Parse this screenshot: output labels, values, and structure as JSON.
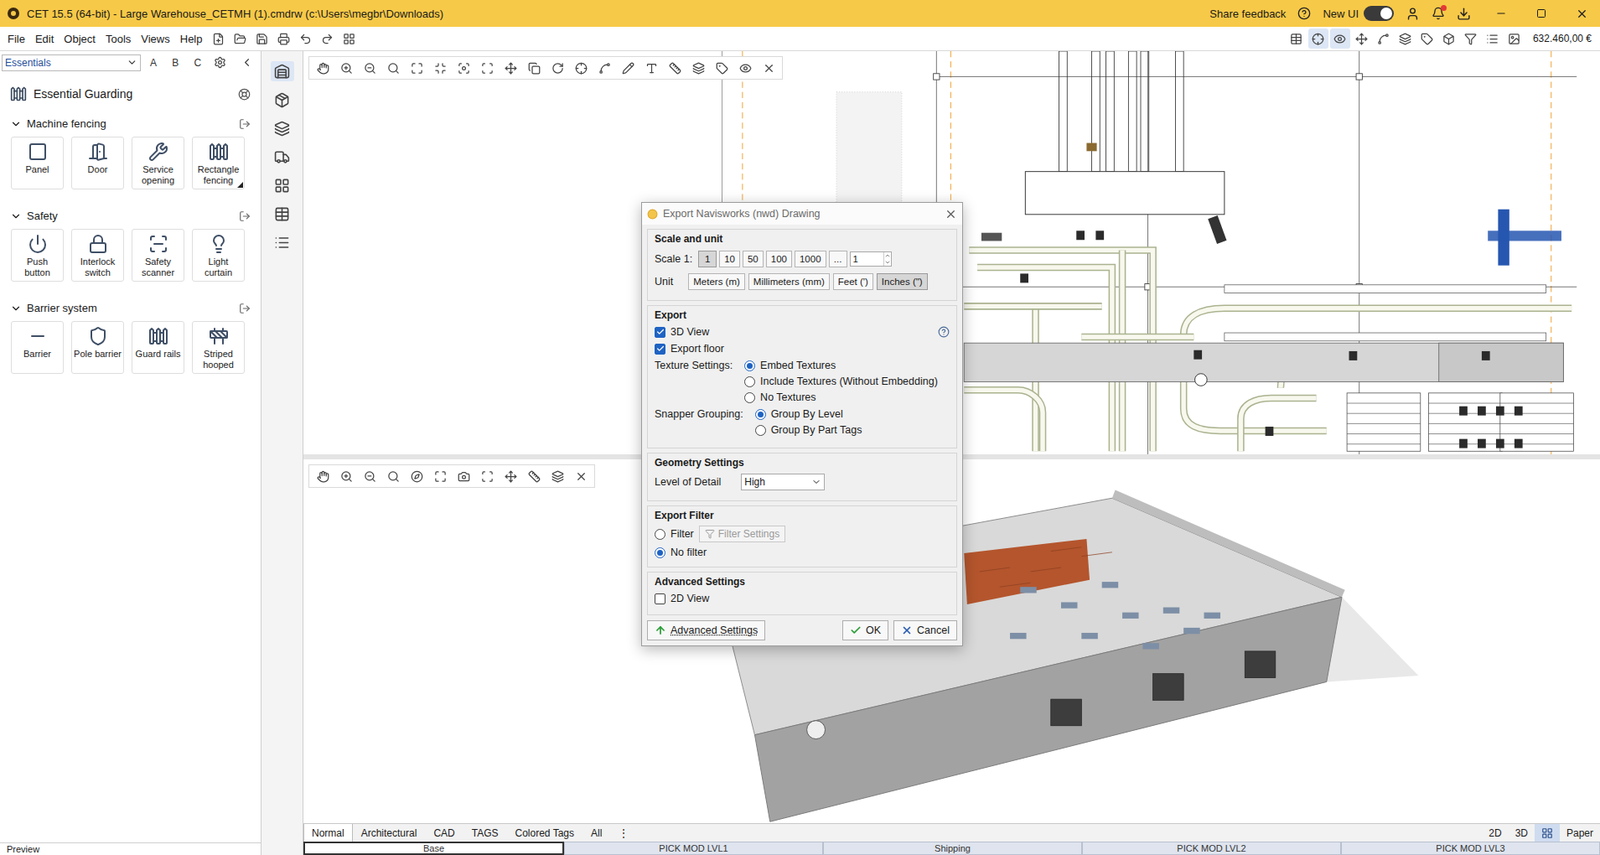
{
  "window": {
    "title": "CET 15.5 (64-bit) - Large Warehouse_CETMH (1).cmdrw (c:\\Users\\megbr\\Downloads)",
    "share_feedback": "Share feedback",
    "new_ui": {
      "label": "New UI",
      "on": true
    },
    "notifications": true
  },
  "menu": [
    "File",
    "Edit",
    "Object",
    "Tools",
    "Views",
    "Help"
  ],
  "total": "632.460,00 €",
  "left_panel": {
    "catalog": "Essentials",
    "letters": [
      "A",
      "B",
      "C"
    ],
    "title": "Essential Guarding",
    "sections": [
      {
        "title": "Machine fencing",
        "expanded": true,
        "items": [
          {
            "label": "Panel",
            "has_variants": false
          },
          {
            "label": "Door",
            "has_variants": false
          },
          {
            "label": "Service opening",
            "has_variants": false
          },
          {
            "label": "Rectangle fencing",
            "has_variants": true
          }
        ]
      },
      {
        "title": "Safety",
        "expanded": true,
        "items": [
          {
            "label": "Push button",
            "has_variants": false
          },
          {
            "label": "Interlock switch",
            "has_variants": false
          },
          {
            "label": "Safety scanner",
            "has_variants": false
          },
          {
            "label": "Light curtain",
            "has_variants": false
          }
        ]
      },
      {
        "title": "Barrier system",
        "expanded": true,
        "items": [
          {
            "label": "Barrier",
            "has_variants": false
          },
          {
            "label": "Pole barrier",
            "has_variants": false
          },
          {
            "label": "Guard rails",
            "has_variants": false
          },
          {
            "label": "Striped hooped",
            "has_variants": false
          }
        ]
      }
    ],
    "footer": "Preview"
  },
  "view_tabs": [
    {
      "label": "Normal",
      "selected": true
    },
    {
      "label": "Architectural",
      "selected": false
    },
    {
      "label": "CAD",
      "selected": false
    },
    {
      "label": "TAGS",
      "selected": false
    },
    {
      "label": "Colored Tags",
      "selected": false
    },
    {
      "label": "All",
      "selected": false
    },
    {
      "label": "⋮",
      "selected": false
    }
  ],
  "view_modes": [
    {
      "kind": "text",
      "label": "2D",
      "selected": false
    },
    {
      "kind": "text",
      "label": "3D",
      "selected": false
    },
    {
      "kind": "icon",
      "label": "",
      "selected": true
    },
    {
      "kind": "text",
      "label": "Paper",
      "selected": false
    }
  ],
  "levels": [
    {
      "label": "Base",
      "selected": true
    },
    {
      "label": "PICK MOD LVL1",
      "selected": false
    },
    {
      "label": "Shipping",
      "selected": false
    },
    {
      "label": "PICK MOD LVL2",
      "selected": false
    },
    {
      "label": "PICK MOD LVL3",
      "selected": false
    }
  ],
  "dialog": {
    "title": "Export Navisworks (nwd) Drawing",
    "scale_group": "Scale and unit",
    "scale_label": "Scale 1:",
    "scales": [
      {
        "label": "1",
        "selected": true
      },
      {
        "label": "10",
        "selected": false
      },
      {
        "label": "50",
        "selected": false
      },
      {
        "label": "100",
        "selected": false
      },
      {
        "label": "1000",
        "selected": false
      },
      {
        "label": "...",
        "selected": false
      }
    ],
    "scale_value": "1",
    "unit_label": "Unit",
    "units": [
      {
        "label": "Meters (m)",
        "selected": false
      },
      {
        "label": "Millimeters (mm)",
        "selected": false
      },
      {
        "label": "Feet (')",
        "selected": false
      },
      {
        "label": "Inches (\")",
        "selected": true
      }
    ],
    "export_group": "Export",
    "checks": [
      {
        "label": "3D View",
        "checked": true
      },
      {
        "label": "Export floor",
        "checked": true
      }
    ],
    "radio_groups": [
      {
        "label": "Texture Settings:",
        "options": [
          {
            "label": "Embed Textures",
            "selected": true
          },
          {
            "label": "Include Textures (Without Embedding)",
            "selected": false
          },
          {
            "label": "No Textures",
            "selected": false
          }
        ]
      },
      {
        "label": "Snapper Grouping:",
        "options": [
          {
            "label": "Group By Level",
            "selected": true
          },
          {
            "label": "Group By Part Tags",
            "selected": false
          }
        ]
      }
    ],
    "geometry_group": "Geometry Settings",
    "lod_label": "Level of Detail",
    "lod_value": "High",
    "filter_group": "Export Filter",
    "filter_options": [
      {
        "label": "Filter",
        "selected": false
      },
      {
        "label": "No filter",
        "selected": true
      }
    ],
    "filter_button": {
      "label": "Filter Settings",
      "disabled": true
    },
    "advanced_group": "Advanced Settings",
    "advanced_checks": [
      {
        "label": "2D View",
        "checked": false
      }
    ],
    "advanced_button": "Advanced Settings",
    "ok": "OK",
    "cancel": "Cancel"
  }
}
